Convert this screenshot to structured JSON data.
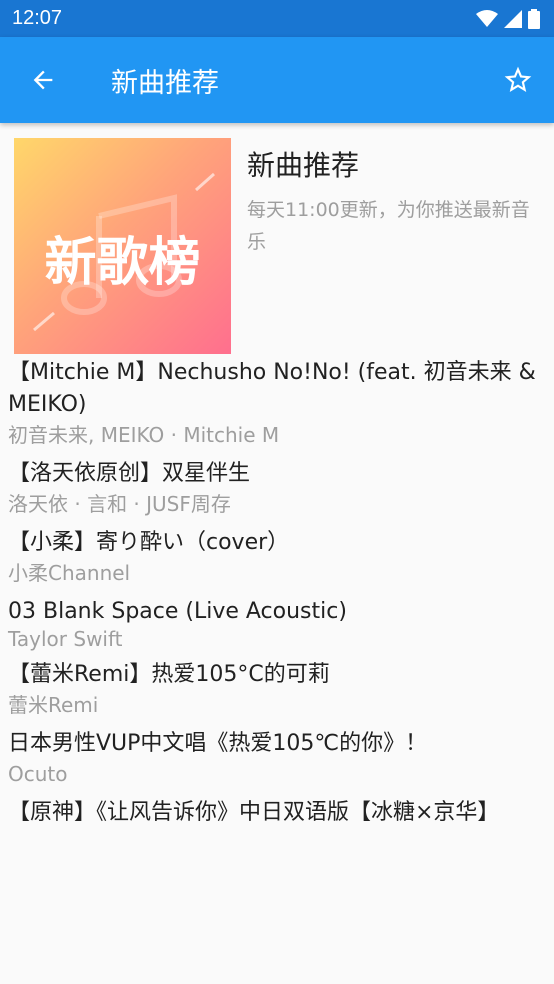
{
  "status": {
    "time": "12:07"
  },
  "app_bar": {
    "title": "新曲推荐"
  },
  "header": {
    "cover_text": "新歌榜",
    "title": "新曲推荐",
    "description": "每天11:00更新，为你推送最新音乐"
  },
  "songs": [
    {
      "title": "【Mitchie M】Nechusho No!No! (feat. 初音未来 & MEIKO)",
      "artist": "初音未来, MEIKO · Mitchie M"
    },
    {
      "title": "【洛天依原创】双星伴生",
      "artist": "洛天依 · 言和 · JUSF周存"
    },
    {
      "title": "【小柔】寄り酔い（cover）",
      "artist": "小柔Channel"
    },
    {
      "title": "03 Blank Space (Live Acoustic)",
      "artist": "Taylor Swift"
    },
    {
      "title": "【蕾米Remi】热爱105°C的可莉",
      "artist": "蕾米Remi"
    },
    {
      "title": "日本男性VUP中文唱《热爱105℃的你》！",
      "artist": "Ocuto"
    },
    {
      "title": "【原神】《让风告诉你》中日双语版【冰糖×京华】",
      "artist": ""
    }
  ]
}
